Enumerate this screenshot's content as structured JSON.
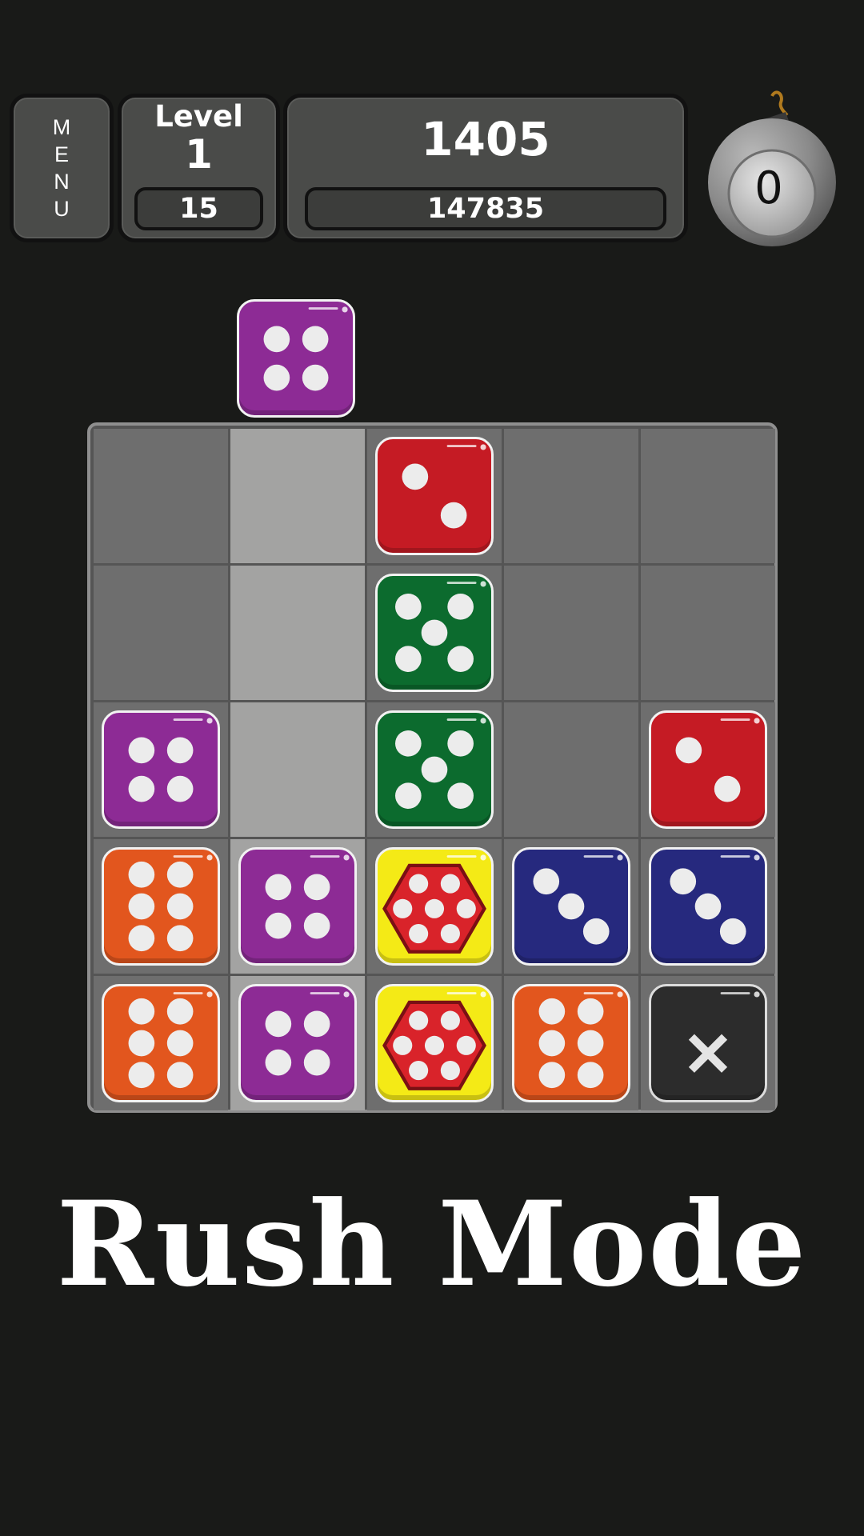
{
  "hud": {
    "menu_letters": [
      "M",
      "E",
      "N",
      "U"
    ],
    "level_label": "Level",
    "level_value": "1",
    "moves": "15",
    "score": "1405",
    "target": "147835",
    "bomb_count": "0"
  },
  "colors": {
    "purple": "#8d2b95",
    "red": "#c51b24",
    "green": "#0c6b2e",
    "orange": "#e2561e",
    "blue": "#26297e",
    "yellow": "#f4ea16",
    "black": "#2c2c2c",
    "pip": "#ececec"
  },
  "falling_piece": {
    "color": "purple",
    "pips": 4,
    "column": 1
  },
  "board": {
    "columns": 5,
    "rows": 5,
    "highlight_column": 1,
    "grid": [
      [
        null,
        null,
        {
          "color": "red",
          "pips": 2
        },
        null,
        null
      ],
      [
        null,
        null,
        {
          "color": "green",
          "pips": 5
        },
        null,
        null
      ],
      [
        {
          "color": "purple",
          "pips": 4
        },
        null,
        {
          "color": "green",
          "pips": 5
        },
        null,
        {
          "color": "red",
          "pips": 2
        }
      ],
      [
        {
          "color": "orange",
          "pips": 6
        },
        {
          "color": "purple",
          "pips": 4
        },
        {
          "color": "yellow",
          "pips": 7
        },
        {
          "color": "blue",
          "pips": 3
        },
        {
          "color": "blue",
          "pips": 3
        }
      ],
      [
        {
          "color": "orange",
          "pips": 6
        },
        {
          "color": "purple",
          "pips": 4
        },
        {
          "color": "yellow",
          "pips": 7
        },
        {
          "color": "orange",
          "pips": 6
        },
        {
          "color": "black",
          "pips": "x"
        }
      ]
    ]
  },
  "mode_title": "Rush Mode"
}
